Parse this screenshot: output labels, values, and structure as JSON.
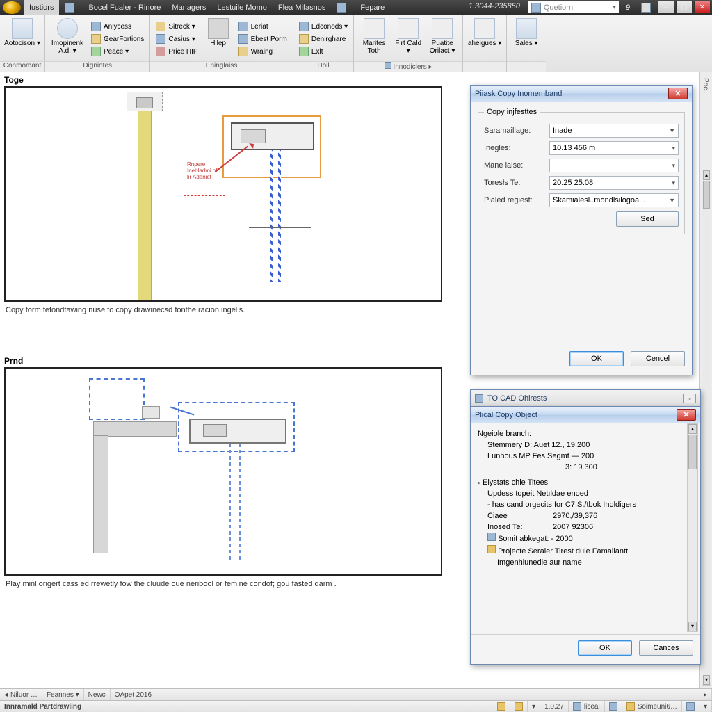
{
  "menubar": {
    "items": [
      "Iustiors",
      "",
      "Bocel Fualer - Rinore",
      "Managers",
      "Lestuile Momo",
      "Flea Mifasnos",
      "",
      "Fepare"
    ],
    "coord": "1.3044-235850",
    "search_placeholder": "Quetiorn",
    "help_badge": "9"
  },
  "ribbon": {
    "groups": [
      {
        "caption": "Conmomant",
        "big": [
          {
            "label": "Aotocison ▾"
          }
        ]
      },
      {
        "caption": "Digniotes",
        "big": [
          {
            "label": "Imopinenk A.d. ▾"
          }
        ],
        "stack": [
          {
            "icon": "blue",
            "label": "Anlycess"
          },
          {
            "icon": "",
            "label": "GearFortions"
          },
          {
            "icon": "green",
            "label": "Peace ▾"
          }
        ]
      },
      {
        "caption": "Eninglaiss",
        "stack1": [
          {
            "icon": "",
            "label": "Sitreck ▾"
          },
          {
            "icon": "blue",
            "label": "Casius ▾"
          },
          {
            "icon": "red",
            "label": "Price HIP"
          }
        ],
        "big": [
          {
            "label": "Hilep"
          }
        ],
        "stack2": [
          {
            "icon": "blue",
            "label": "Leriat"
          },
          {
            "icon": "blue",
            "label": "Ebest Porm"
          },
          {
            "icon": "",
            "label": "Wraing"
          }
        ]
      },
      {
        "caption": "Hoil",
        "stack": [
          {
            "icon": "blue",
            "label": "Edconods ▾"
          },
          {
            "icon": "",
            "label": "Denirghare"
          },
          {
            "icon": "green",
            "label": "Exlt"
          }
        ]
      },
      {
        "caption": "Innodiclers ▸",
        "bigs": [
          {
            "label": "Marites Toth"
          },
          {
            "label": "Firt Cald ▾"
          },
          {
            "label": "Puatite Orilact ▾"
          }
        ]
      },
      {
        "caption": "",
        "big": [
          {
            "label": "aheigues ▾"
          }
        ]
      },
      {
        "caption": "",
        "big": [
          {
            "label": "Sales ▾"
          }
        ]
      }
    ]
  },
  "sections": {
    "top": {
      "label": "Toge",
      "callout": "Rnpere Inebladmi of lir Adenict",
      "caption": "Copy form fefondtawing nuse to copy drawinecsd fonthe racion ingelis."
    },
    "bottom": {
      "label": "Prnd",
      "caption": "Play minl origert cass ed rrewetly fow the cluude oue neribool or femine condof; gou fasted darm ."
    }
  },
  "dialog1": {
    "title": "Piiask Copy Inomemband",
    "legend": "Copy injfesttes",
    "rows": [
      {
        "label": "Saramaillage:",
        "value": "Inade",
        "dd": true
      },
      {
        "label": "Inegles:",
        "value": "10.13 456 m",
        "dd": true
      },
      {
        "label": "Mane ialse:",
        "value": "",
        "dd": true
      },
      {
        "label": "Toresłs Te:",
        "value": "20.25 25.08",
        "dd": true
      },
      {
        "label": "Pialed regiest:",
        "value": "Skamialesl..mondlsilogoa...",
        "dd": true
      }
    ],
    "mid_button": "Sed",
    "ok": "OK",
    "cancel": "Cencel"
  },
  "dialog2": {
    "outer_title": "TO CAD Ohirests",
    "title": "Plical Copy Object",
    "root": "Ngeiole branch:",
    "rows": [
      "Stemmery D: Auet 12.,  19.200",
      "Lunhous MP Fes Segmt  —  200",
      "3:   19.300"
    ],
    "group2": "Elystats chle Titees",
    "g2rows": [
      "Updess topeit Netıldae enoed",
      "- has cand orgecits for C7.S./tbok Inoldigers"
    ],
    "kv": [
      {
        "k": "Ciaee",
        "v": "2970,/39,376"
      },
      {
        "k": "Inosed Te:",
        "v": "2007 92306"
      }
    ],
    "leaf1": "Somit abkegat: - 2000",
    "leaf2": "Projecte Seraler Tirest dule Famailantt",
    "leaf3": "Imgenhiunedle aur name",
    "ok": "OK",
    "cancel": "Cances"
  },
  "statusbar": {
    "upper": [
      "Niluor …",
      "Feannes ▾",
      "Newc",
      "OApet 2016"
    ],
    "lower_left": "Innramald Partdrawiing",
    "lower_cells": [
      "1.0.27",
      "liceal",
      "Soimeuni6…"
    ]
  },
  "right_slim": "Poc.."
}
